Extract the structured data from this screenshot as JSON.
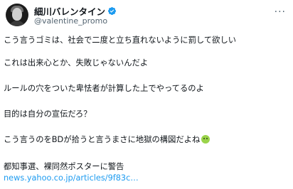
{
  "author": {
    "display_name": "細川バレンタイン",
    "handle": "@valentine_promo",
    "verified_icon": "verified-badge-icon",
    "more_icon": "more-options-icon"
  },
  "tweet": {
    "lines": [
      "こう言うゴミは、社会で二度と立ち直れないように罰して欲しい",
      "これは出来心とか、失敗じゃないんだよ",
      "ルールの穴をついた卑怯者が計算した上でやってるのよ",
      "目的は自分の宣伝だろ？",
      "こう言うのをBDが拾うと言うまさに地獄の構図だよね",
      "都知事選、裸同然ポスターに警告"
    ],
    "emoji_icon": "nauseated-face-emoji-icon",
    "link_text": "news.yahoo.co.jp/articles/9f83c…"
  },
  "colors": {
    "text": "#0f1419",
    "secondary": "#536471",
    "link": "#1d9bf0",
    "verified": "#1d9bf0"
  }
}
